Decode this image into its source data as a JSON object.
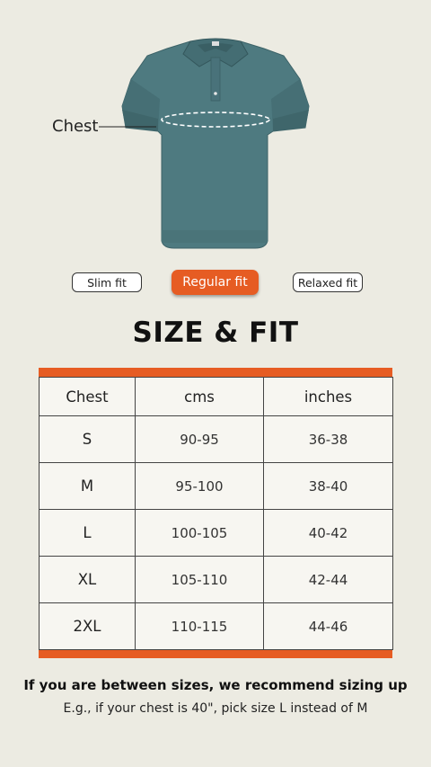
{
  "product": {
    "chest_label": "Chest"
  },
  "fit_options": [
    {
      "label": "Slim fit",
      "active": false
    },
    {
      "label": "Regular fit",
      "active": true
    },
    {
      "label": "Relaxed fit",
      "active": false
    }
  ],
  "title": "SIZE & FIT",
  "table": {
    "headers": [
      "Chest",
      "cms",
      "inches"
    ],
    "rows": [
      {
        "size": "S",
        "cms": "90-95",
        "inches": "36-38"
      },
      {
        "size": "M",
        "cms": "95-100",
        "inches": "38-40"
      },
      {
        "size": "L",
        "cms": "100-105",
        "inches": "40-42"
      },
      {
        "size": "XL",
        "cms": "105-110",
        "inches": "42-44"
      },
      {
        "size": "2XL",
        "cms": "110-115",
        "inches": "44-46"
      }
    ]
  },
  "note": {
    "main": "If you are between sizes, we recommend sizing up",
    "sub": "E.g., if your chest is 40\", pick size L instead of M"
  },
  "colors": {
    "accent": "#e65c23",
    "background": "#ecebe2",
    "shirt": "#4e7a80"
  }
}
